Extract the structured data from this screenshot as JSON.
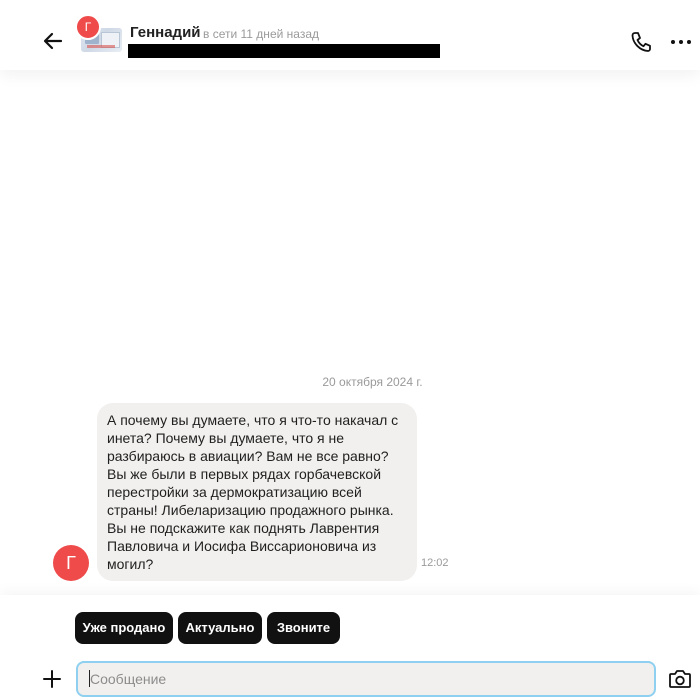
{
  "header": {
    "avatar_letter": "Г",
    "contact_name": "Геннадий",
    "status": "в сети 11 дней назад",
    "icons": {
      "back": "arrow-left-icon",
      "call": "phone-icon",
      "more": "more-dots-icon"
    }
  },
  "chat": {
    "date_separator": "20 октября 2024 г.",
    "messages": [
      {
        "avatar_letter": "Г",
        "text": "А почему вы думаете, что я что-то накачал с инета? Почему вы думаете, что я не разбираюсь в авиации? Вам не все равно? Вы же были в первых рядах горбачевской перестройки за дермократизацию всей страны! Либеларизацию продажного рынка. Вы не подскажите как поднять Лаврентия Павловича и Иосифа Виссарионовича из могил?",
        "time": "12:02"
      }
    ]
  },
  "quick_replies": [
    "Уже продано",
    "Актуально",
    "Звоните"
  ],
  "composer": {
    "placeholder": "Сообщение",
    "value": "",
    "icons": {
      "attach": "plus-icon",
      "camera": "camera-icon"
    }
  },
  "colors": {
    "avatar": "#ef4b4b",
    "bubble": "#f2f0ee",
    "chip": "#111111",
    "input_border": "#8fd0f0"
  }
}
